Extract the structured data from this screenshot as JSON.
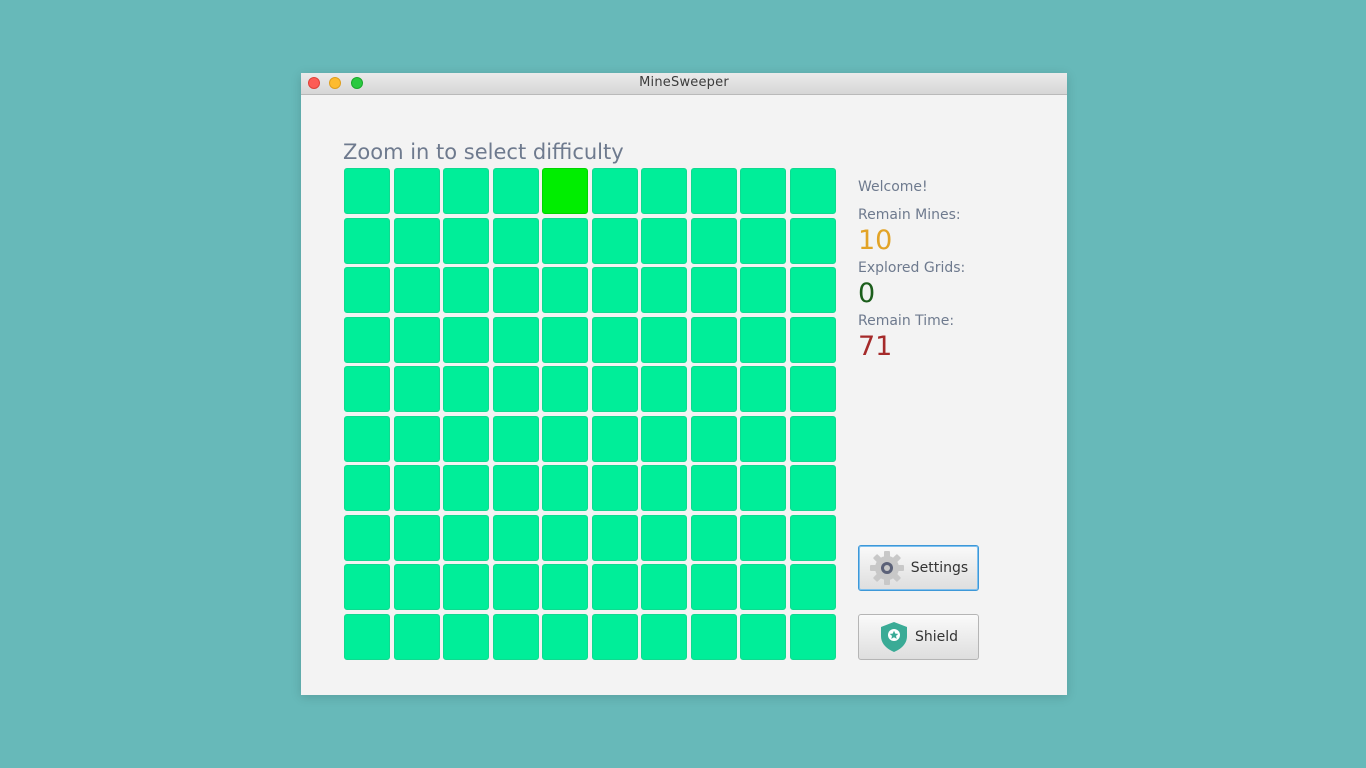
{
  "window": {
    "title": "MineSweeper"
  },
  "prompt": "Zoom in to select difficulty",
  "board": {
    "rows": 10,
    "cols": 10,
    "highlighted_cell": {
      "row": 0,
      "col": 4
    },
    "cell_color": "#00ee99",
    "highlight_color": "#00ee00"
  },
  "stats": {
    "welcome": "Welcome!",
    "remain_mines_label": "Remain Mines:",
    "remain_mines_value": "10",
    "explored_label": "Explored Grids:",
    "explored_value": "0",
    "remain_time_label": "Remain Time:",
    "remain_time_value": "71",
    "colors": {
      "mines": "#e2a326",
      "explored": "#1c5e1c",
      "time": "#a52a2a"
    }
  },
  "buttons": {
    "settings": {
      "label": "Settings",
      "icon": "gear-icon"
    },
    "shield": {
      "label": "Shield",
      "icon": "shield-icon"
    }
  }
}
